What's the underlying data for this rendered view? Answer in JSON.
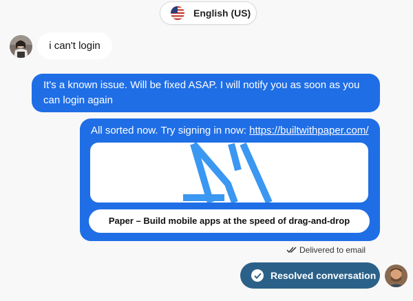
{
  "language": {
    "label": "English (US)",
    "flag_icon": "us-flag-icon"
  },
  "messages": [
    {
      "sender": "user",
      "text": "i can't login"
    },
    {
      "sender": "agent",
      "text": "It's a known issue. Will be fixed ASAP. I will notify you as soon as you can login again"
    },
    {
      "sender": "agent",
      "text": "All sorted now. Try signing in now: ",
      "link_text": "https://builtwithpaper.com/",
      "link_preview": {
        "title": "Paper – Build mobile apps at the speed of drag-and-drop"
      }
    }
  ],
  "delivery_status": "Delivered to email",
  "status_button": {
    "label": "Resolved conversation",
    "icon": "check-circle-icon"
  },
  "colors": {
    "agent_bubble": "#1f6ee6",
    "resolved_button": "#2b6189",
    "background": "#f8f8f8"
  }
}
